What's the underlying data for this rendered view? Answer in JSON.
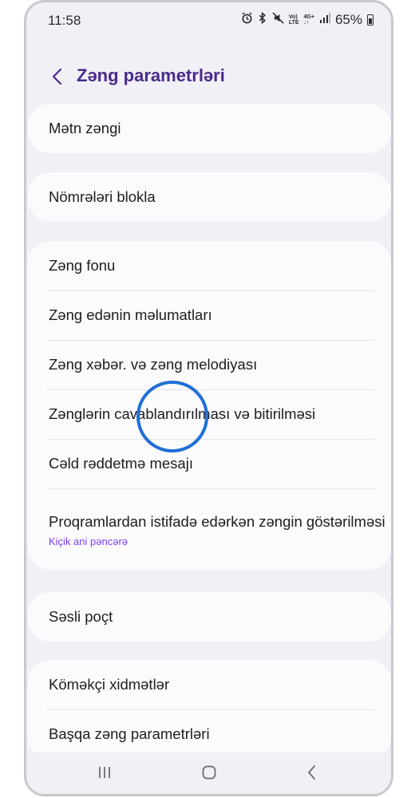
{
  "status_bar": {
    "time": "11:58",
    "battery": "65%",
    "icons": [
      "alarm-icon",
      "bluetooth-icon",
      "mute-icon",
      "volte-icon",
      "4g-icon",
      "signal-icon",
      "battery-icon"
    ]
  },
  "header": {
    "title": "Zəng parametrləri",
    "back_icon": "chevron-left-icon"
  },
  "cards": {
    "c1": {
      "items": [
        {
          "label": "Mətn zəngi"
        }
      ]
    },
    "c2": {
      "items": [
        {
          "label": "Nömrələri blokla"
        }
      ]
    },
    "c3": {
      "items": [
        {
          "label": "Zəng fonu"
        },
        {
          "label": "Zəng edənin məlumatları"
        },
        {
          "label": "Zəng xəbər. və zəng melodiyası"
        },
        {
          "label": "Zənglərin cavablandırılması və bitirilməsi"
        },
        {
          "label": "Cəld rəddetmə mesajı"
        },
        {
          "label": "Proqramlardan istifadə edərkən zəngin göstərilməsi",
          "sub": "Kiçik ani pəncərə"
        }
      ]
    },
    "c4": {
      "items": [
        {
          "label": "Səsli poçt"
        }
      ]
    },
    "c5": {
      "items": [
        {
          "label": "Köməkçi xidmətlər"
        },
        {
          "label": "Başqa zəng parametrləri"
        }
      ]
    }
  },
  "navbar": {
    "recent_icon": "recent-apps-icon",
    "home_icon": "home-icon",
    "back_icon": "back-icon"
  },
  "colors": {
    "title": "#4a2a8a",
    "accent_sub": "#7b3ff2",
    "highlight": "#1f6fd6",
    "background": "#f1f0f6",
    "card": "#fbfbfd"
  }
}
